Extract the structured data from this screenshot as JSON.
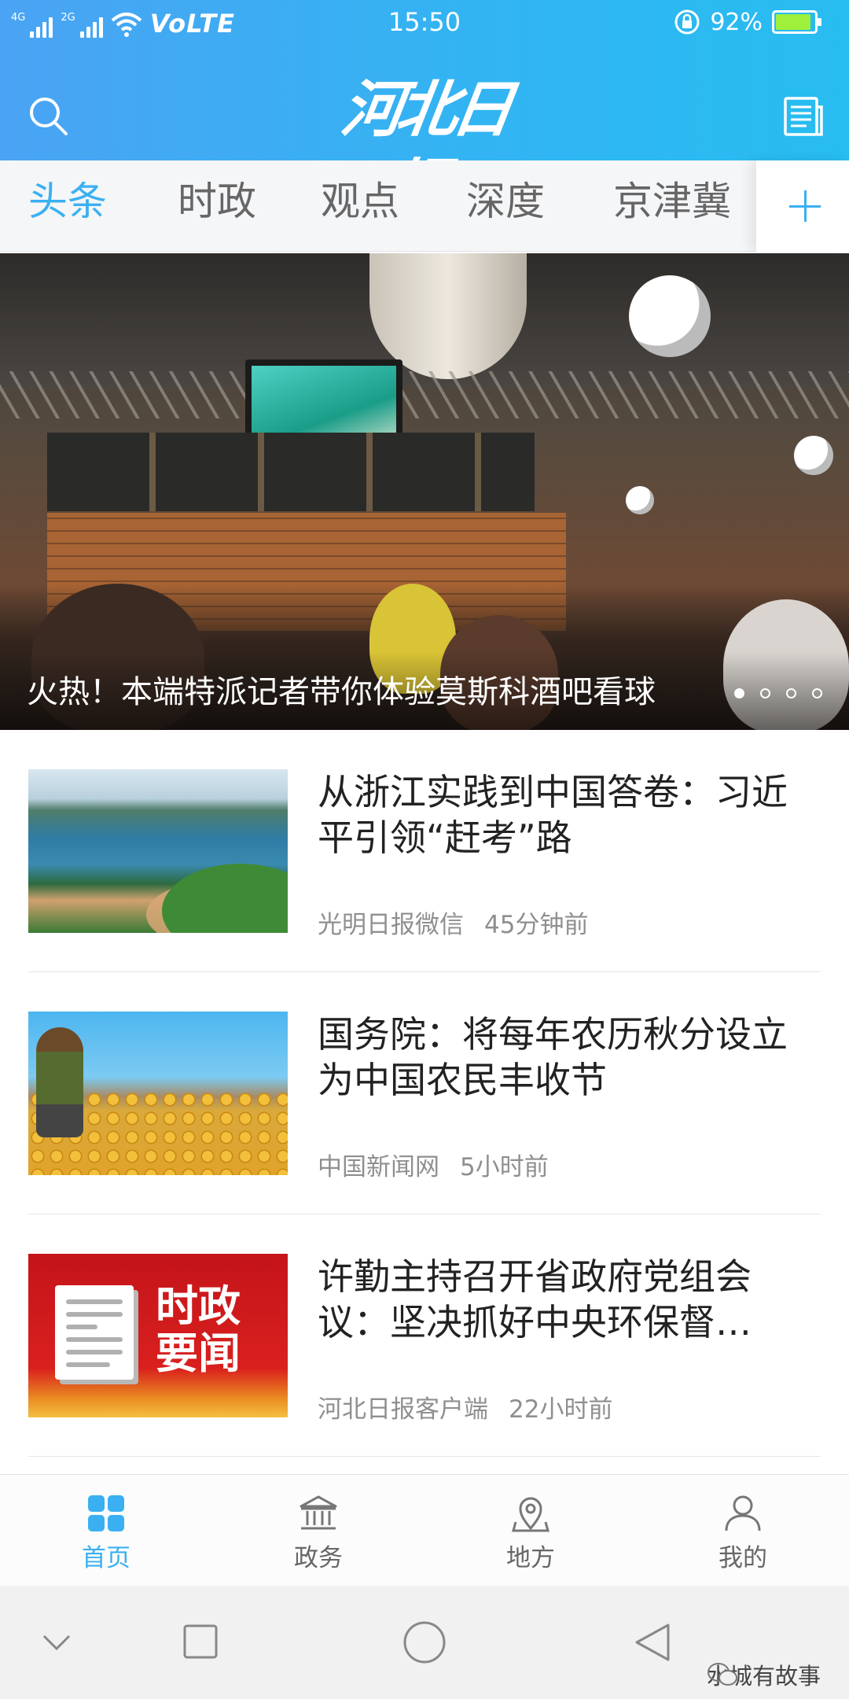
{
  "status_bar": {
    "network_1": "4G",
    "network_2": "2G",
    "volte": "VoLTE",
    "time": "15:50",
    "battery_percent": "92%",
    "battery_level": 0.92,
    "icons": [
      "signal-icon",
      "wifi-icon",
      "rotation-lock-icon",
      "battery-charging-icon"
    ]
  },
  "header": {
    "logo_text": "河北日报",
    "search_icon": "search-icon",
    "paper_icon": "newspaper-icon",
    "colors": {
      "gradient_start": "#4aa3f4",
      "gradient_end": "#27bdf0"
    }
  },
  "tabs": {
    "items": [
      "头条",
      "时政",
      "观点",
      "深度",
      "京津冀"
    ],
    "active": "头条",
    "add_icon": "plus-icon",
    "accent": "#3ab0f2"
  },
  "banner": {
    "caption": "火热！本端特派记者带你体验莫斯科酒吧看球",
    "page_index": 1,
    "page_count": 4
  },
  "news": [
    {
      "title": "从浙江实践到中国答卷：习近平引领“赶考”路",
      "source": "光明日报微信",
      "time": "45分钟前"
    },
    {
      "title": "国务院：将每年农历秋分设立为中国农民丰收节",
      "source": "中国新闻网",
      "time": "5小时前"
    },
    {
      "title": "许勤主持召开省政府党组会议：坚决抓好中央环保督…",
      "source": "河北日报客户端",
      "time": "22小时前",
      "thumb_text": "时政要闻"
    }
  ],
  "bottom_nav": {
    "items": [
      {
        "label": "首页",
        "icon": "home-grid-icon"
      },
      {
        "label": "政务",
        "icon": "government-building-icon"
      },
      {
        "label": "地方",
        "icon": "location-pin-icon"
      },
      {
        "label": "我的",
        "icon": "profile-icon"
      }
    ],
    "active": "首页"
  },
  "system_nav": {
    "icons": [
      "chevron-down-icon",
      "recents-square-icon",
      "home-circle-icon",
      "back-triangle-icon"
    ],
    "watermark": "水城有故事"
  }
}
